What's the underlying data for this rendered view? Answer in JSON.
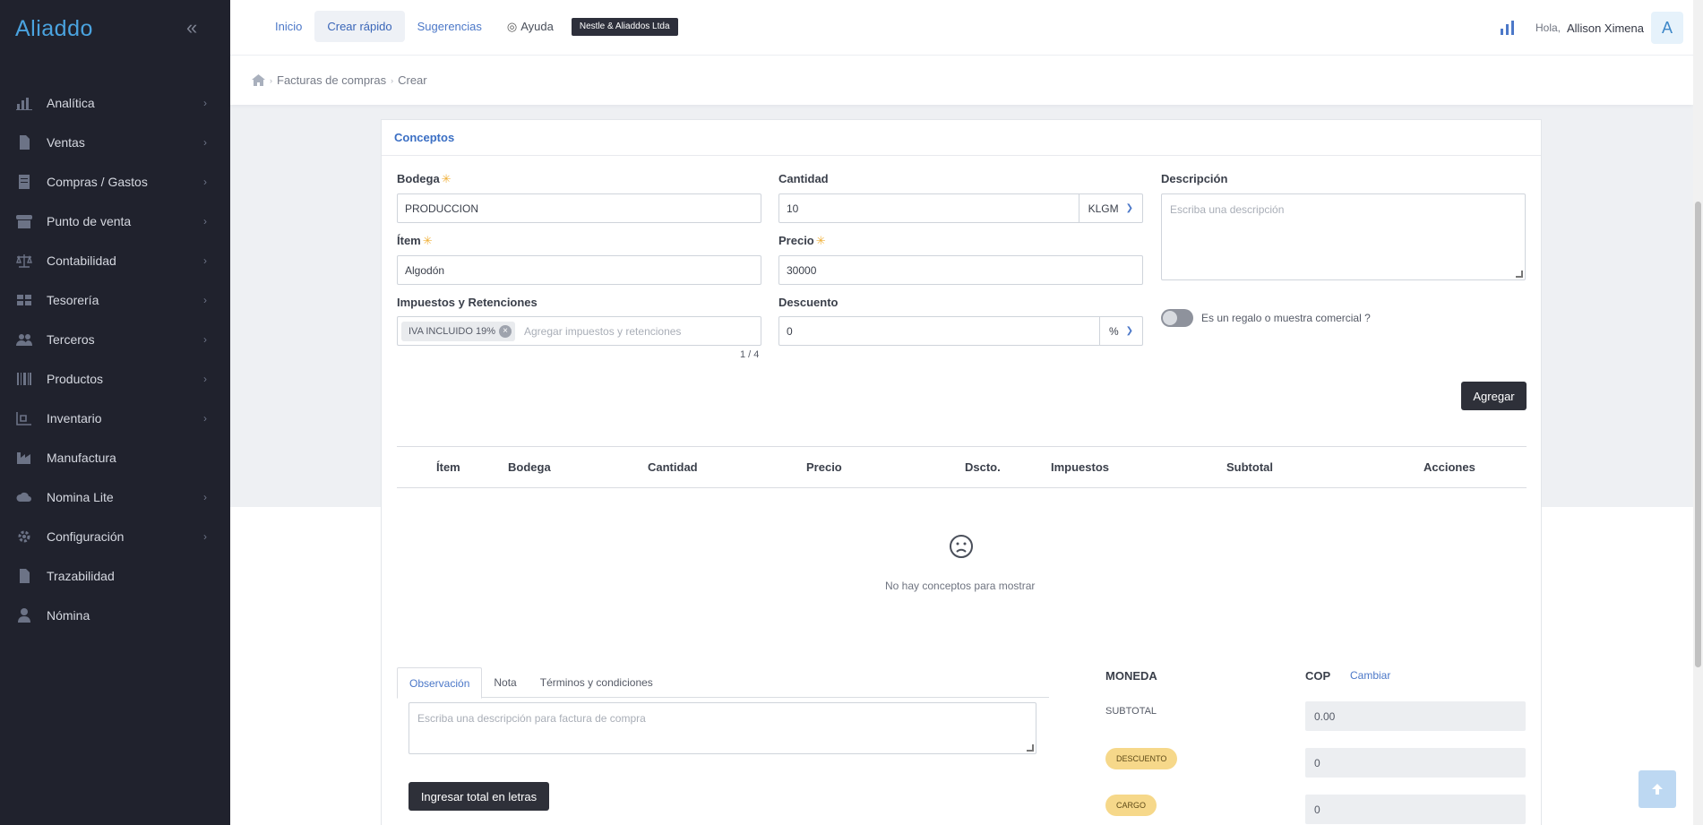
{
  "app": {
    "logo": "Aliaddo"
  },
  "sidebar": {
    "items": [
      {
        "label": "Analítica",
        "icon": "bar-chart-icon",
        "arrow": true
      },
      {
        "label": "Ventas",
        "icon": "document-icon",
        "arrow": true
      },
      {
        "label": "Compras / Gastos",
        "icon": "receipt-icon",
        "arrow": true
      },
      {
        "label": "Punto de venta",
        "icon": "store-icon",
        "arrow": true
      },
      {
        "label": "Contabilidad",
        "icon": "scale-icon",
        "arrow": true
      },
      {
        "label": "Tesorería",
        "icon": "treasury-icon",
        "arrow": true
      },
      {
        "label": "Terceros",
        "icon": "users-icon",
        "arrow": true
      },
      {
        "label": "Productos",
        "icon": "barcode-icon",
        "arrow": true
      },
      {
        "label": "Inventario",
        "icon": "forklift-icon",
        "arrow": true
      },
      {
        "label": "Manufactura",
        "icon": "factory-icon",
        "arrow": false
      },
      {
        "label": "Nomina Lite",
        "icon": "cloud-icon",
        "arrow": true
      },
      {
        "label": "Configuración",
        "icon": "gear-icon",
        "arrow": true
      },
      {
        "label": "Trazabilidad",
        "icon": "file-icon",
        "arrow": false
      },
      {
        "label": "Nómina",
        "icon": "user-icon",
        "arrow": false
      }
    ]
  },
  "topbar": {
    "links": {
      "inicio": "Inicio",
      "crear": "Crear rápido",
      "sugerencias": "Sugerencias",
      "ayuda": "Ayuda"
    },
    "company": "Nestle & Aliaddos Ltda",
    "greeting": "Hola,",
    "user": "Allison Ximena",
    "avatar": "A"
  },
  "breadcrumb": {
    "section": "Facturas de compras",
    "page": "Crear"
  },
  "form": {
    "card_title": "Conceptos",
    "bodega": {
      "label": "Bodega",
      "value": "PRODUCCION"
    },
    "cantidad": {
      "label": "Cantidad",
      "value": "10",
      "unit": "KLGM"
    },
    "descripcion": {
      "label": "Descripción",
      "placeholder": "Escriba una descripción"
    },
    "item": {
      "label": "Ítem",
      "value": "Algodón"
    },
    "precio": {
      "label": "Precio",
      "value": "30000"
    },
    "impuestos": {
      "label": "Impuestos y Retenciones",
      "chip": "IVA INCLUIDO 19%",
      "placeholder": "Agregar impuestos y retenciones",
      "counter": "1 / 4"
    },
    "descuento": {
      "label": "Descuento",
      "value": "0",
      "unit": "%"
    },
    "regalo": {
      "label": "Es un regalo o muestra comercial ?",
      "on": false
    },
    "add_button": "Agregar"
  },
  "table": {
    "columns": [
      "Ítem",
      "Bodega",
      "Cantidad",
      "Precio",
      "Dscto.",
      "Impuestos",
      "Subtotal",
      "Acciones"
    ],
    "empty_text": "No hay conceptos para mostrar"
  },
  "notes": {
    "tabs": [
      "Observación",
      "Nota",
      "Términos y condiciones"
    ],
    "placeholder": "Escriba una descripción para factura de compra",
    "total_letters_button": "Ingresar total en letras"
  },
  "summary": {
    "moneda_label": "MONEDA",
    "moneda_value": "COP",
    "cambiar": "Cambiar",
    "subtotal_label": "SUBTOTAL",
    "subtotal_value": "0.00",
    "descuento_label": "DESCUENTO",
    "descuento_value": "0",
    "cargo_label": "CARGO",
    "cargo_value": "0"
  },
  "colors": {
    "sidebar": "#20222d",
    "accent": "#4c78c8",
    "dark_button": "#2e3039",
    "pill": "#f6d88a"
  }
}
